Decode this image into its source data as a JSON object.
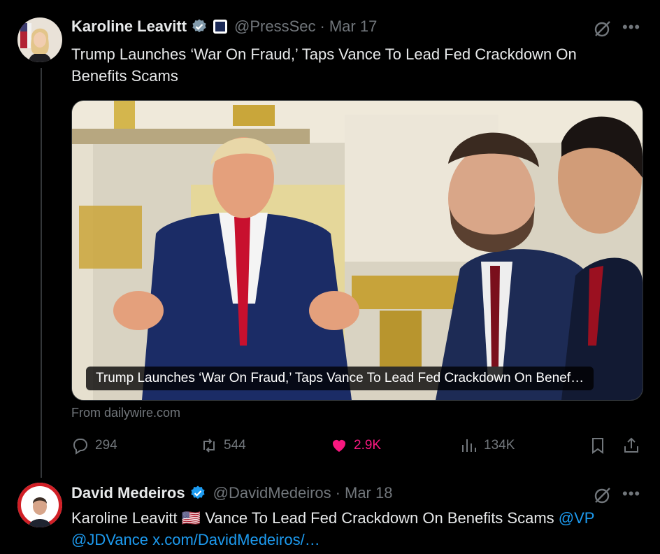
{
  "tweet1": {
    "display_name": "Karoline Leavitt",
    "handle": "@PressSec",
    "separator": "·",
    "date": "Mar 17",
    "text": "Trump Launches ‘War On Fraud,’ Taps Vance To Lead Fed Crackdown On Benefits Scams",
    "card_caption": "Trump Launches ‘War On Fraud,’ Taps Vance To Lead Fed Crackdown On Benef…",
    "card_source": "From dailywire.com",
    "replies": "294",
    "reposts": "544",
    "likes": "2.9K",
    "views": "134K",
    "icons": [
      "verified-badge-icon",
      "white-house-affiliation-icon",
      "grok-icon",
      "more-icon",
      "reply-icon",
      "repost-icon",
      "like-icon",
      "views-icon",
      "bookmark-icon",
      "share-icon"
    ]
  },
  "tweet2": {
    "display_name": "David Medeiros",
    "handle": "@DavidMedeiros",
    "separator": "·",
    "date": "Mar 18",
    "text_prefix": "Karoline Leavitt",
    "flag": "🇺🇸",
    "text_main": "Vance To Lead Fed Crackdown On Benefits Scams",
    "mention_vp": "@VP",
    "mention_jdvance": "@JDVance",
    "link": "x.com/DavidMedeiros/…"
  },
  "colors": {
    "background": "#000000",
    "text": "#e7e9ea",
    "muted": "#71767b",
    "accent": "#1d9bf0",
    "like": "#f91880"
  }
}
